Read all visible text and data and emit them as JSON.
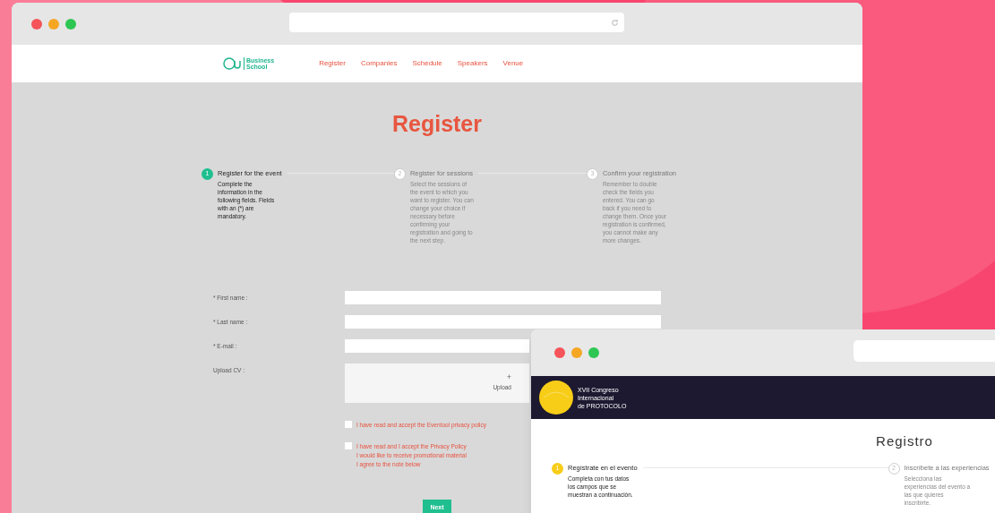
{
  "register_window": {
    "logo": [
      "Business",
      "School"
    ],
    "nav": [
      {
        "label": "Register"
      },
      {
        "label": "Companies"
      },
      {
        "label": "Schedule"
      },
      {
        "label": "Speakers"
      },
      {
        "label": "Venue"
      }
    ],
    "title": "Register",
    "steps": [
      {
        "number": "1",
        "title": "Register for the event",
        "text": "Complete the information in the following fields. Fields with an (*) are mandatory.",
        "selected": true
      },
      {
        "number": "2",
        "title": "Register for sessions",
        "text": "Select the sessions of the event to which you want to register. You can change your choice if necessary before confirming your registration and going to the next step.",
        "selected": false
      },
      {
        "number": "3",
        "title": "Confirm your registration",
        "text": "Remember to double check the fields you entered. You can go back if you need to change them. Once your registration is confirmed, you cannot make any more changes.",
        "selected": false
      }
    ],
    "fields": [
      {
        "kind": "text",
        "label": "* First name :"
      },
      {
        "kind": "text",
        "label": "* Last name :"
      },
      {
        "kind": "text",
        "label": "* E-mail :"
      },
      {
        "kind": "upload",
        "label": "Upload CV :",
        "icon": "+",
        "button": "Upload"
      }
    ],
    "consents": [
      {
        "lines": [
          "I have read and accept the Eventool privacy policy"
        ],
        "checked": false
      },
      {
        "lines": [
          "I have read and I accept the Privacy Policy",
          "I would like to receive promotional material",
          "I agree to the note below"
        ],
        "checked": false
      }
    ],
    "next_button": "Next"
  },
  "registro_window": {
    "logo": [
      "XVII Congreso",
      "Internacional",
      "de PROTOCOLO"
    ],
    "title": "Registro",
    "steps": [
      {
        "number": "1",
        "title": "Regístrate en el evento",
        "text": "Completa con tus datos los campos que se muestran a continuación.",
        "selected": true
      },
      {
        "number": "2",
        "title": "Inscríbete a las experiencias",
        "text": "Selecciona las experiencias del evento a las que quieres inscribirte.",
        "selected": false
      }
    ]
  }
}
